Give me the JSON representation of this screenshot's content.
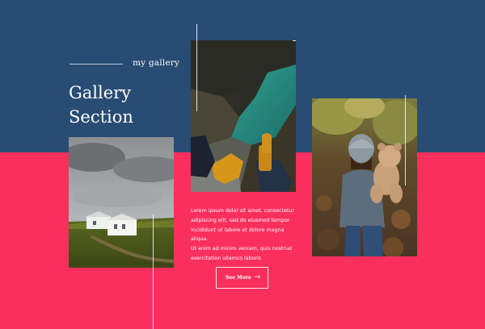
{
  "gallery": {
    "subtitle": "my gallery",
    "title_line1": "Gallery",
    "title_line2": "Section",
    "description": "Lorem ipsum dolor sit amet, consectetur\nadipiscing elit, sed do eiusmod tempor\nincididunt ut labore et dolore magna aliqua.\nUt enim ad minim veniam, quis nostrud\nexercitation ullamco laboris",
    "button_label": "See More",
    "button_icon": "arrow-right-icon"
  },
  "photos": [
    {
      "name": "house-landscape-photo"
    },
    {
      "name": "boots-river-photo"
    },
    {
      "name": "child-teddy-bear-photo"
    }
  ],
  "colors": {
    "top_band": "#284c73",
    "bottom_band": "#fb2f5d",
    "text": "#ffffff"
  }
}
